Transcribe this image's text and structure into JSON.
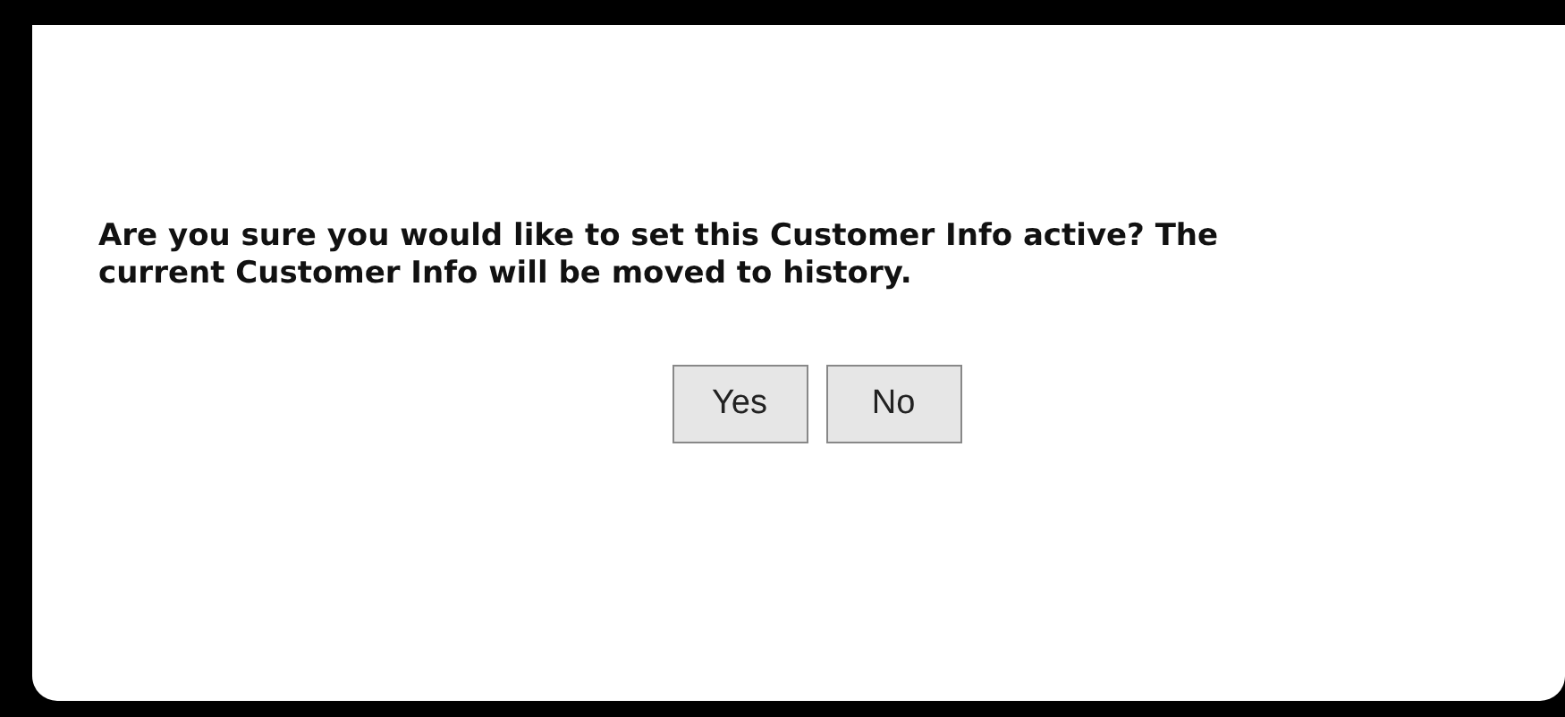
{
  "dialog": {
    "message": "Are you sure you would like to set this Customer Info active? The current Customer Info will be moved to history.",
    "buttons": [
      "Yes",
      "No"
    ]
  }
}
